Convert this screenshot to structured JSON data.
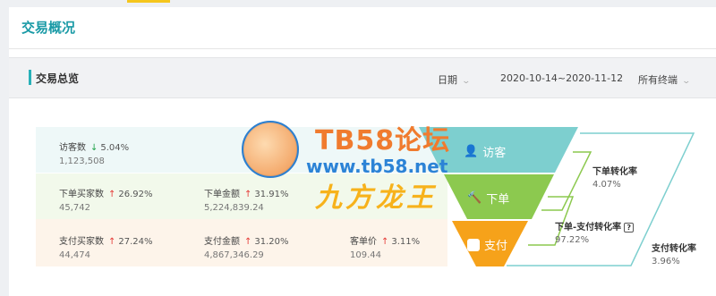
{
  "page_title": "交易概况",
  "toolbar": {
    "section_label": "交易总览",
    "date_label": "日期",
    "date_range": "2020-10-14~2020-11-12",
    "terminal_label": "所有终端"
  },
  "rows": {
    "visitors": {
      "metrics": [
        {
          "name": "访客数",
          "direction": "down",
          "pct": "5.04%",
          "value": "1,123,508"
        }
      ]
    },
    "orders": {
      "metrics": [
        {
          "name": "下单买家数",
          "direction": "up",
          "pct": "26.92%",
          "value": "45,742"
        },
        {
          "name": "下单金额",
          "direction": "up",
          "pct": "31.91%",
          "value": "5,224,839.24"
        }
      ]
    },
    "payments": {
      "metrics": [
        {
          "name": "支付买家数",
          "direction": "up",
          "pct": "27.24%",
          "value": "44,474"
        },
        {
          "name": "支付金额",
          "direction": "up",
          "pct": "31.20%",
          "value": "4,867,346.29"
        },
        {
          "name": "客单价",
          "direction": "up",
          "pct": "3.11%",
          "value": "109.44"
        }
      ]
    }
  },
  "funnel": {
    "stages": [
      {
        "label": "访客",
        "color": "#7dcfcf",
        "icon": "user-icon"
      },
      {
        "label": "下单",
        "color": "#8cc94f",
        "icon": "hammer-icon"
      },
      {
        "label": "支付",
        "color": "#f6a21a",
        "icon": "wallet-icon"
      }
    ],
    "conversions": [
      {
        "name": "下单转化率",
        "value": "4.07%",
        "color": "#8cc94f"
      },
      {
        "name": "下单-支付转化率",
        "value": "97.22%",
        "color": "#8cc94f"
      },
      {
        "name": "支付转化率",
        "value": "3.96%",
        "color": "#f6c96a"
      }
    ],
    "outline_color": "#7dcfcf"
  },
  "watermark": {
    "line1": "TB58论坛",
    "line2": "www.tb58.net",
    "line3": "九方龙王"
  },
  "colors": {
    "accent": "#1a9aa6",
    "up": "#e53935",
    "down": "#1fa24a"
  }
}
